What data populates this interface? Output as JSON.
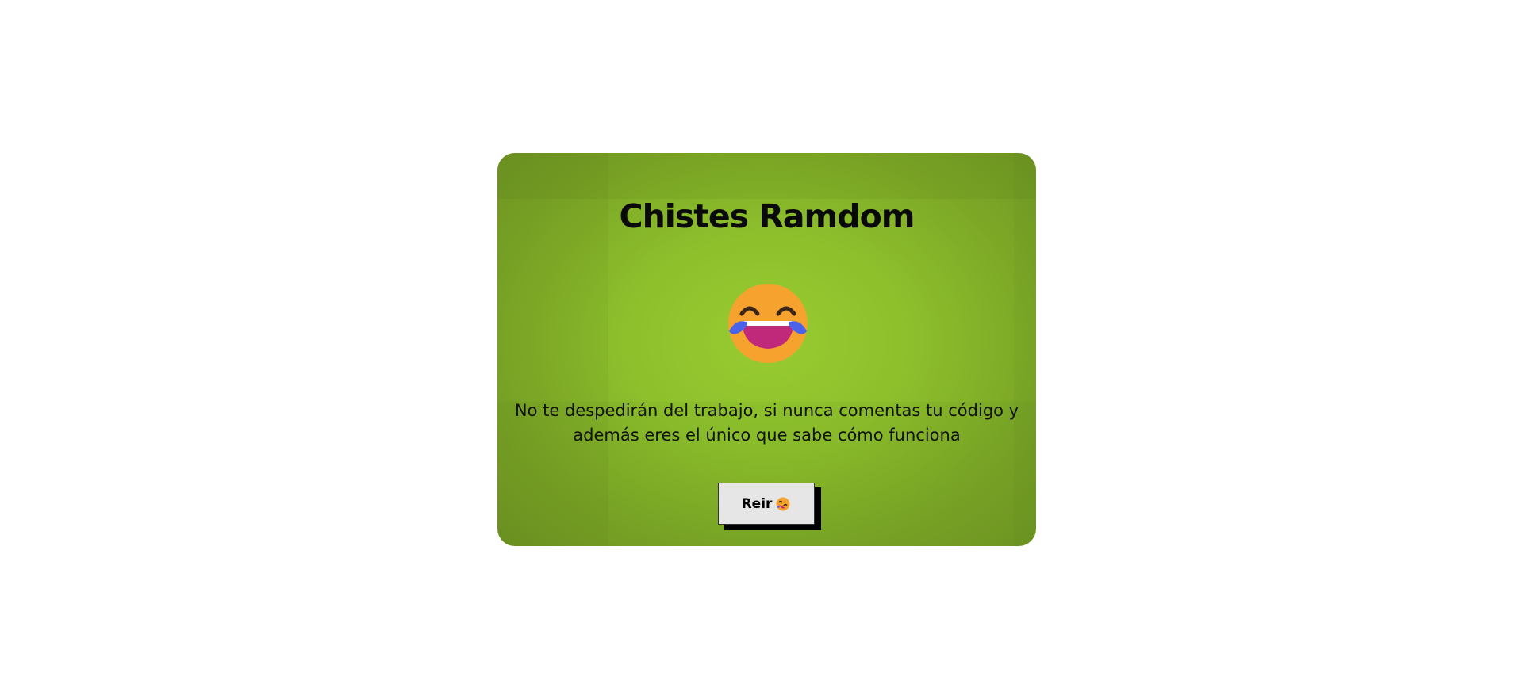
{
  "card": {
    "title": "Chistes Ramdom",
    "emoji": "face-with-tears-of-joy-icon",
    "joke": "No te despedirán del trabajo, si nunca comentas tu código y además eres el único que sabe cómo funciona",
    "button": {
      "label": "Reir",
      "icon": "rolling-on-floor-laughing-icon"
    }
  },
  "colors": {
    "card_background": "#8dbf2c",
    "page_background": "#ffffff",
    "button_background": "#e6e6e6",
    "button_shadow": "#000000",
    "text": "#111111"
  }
}
